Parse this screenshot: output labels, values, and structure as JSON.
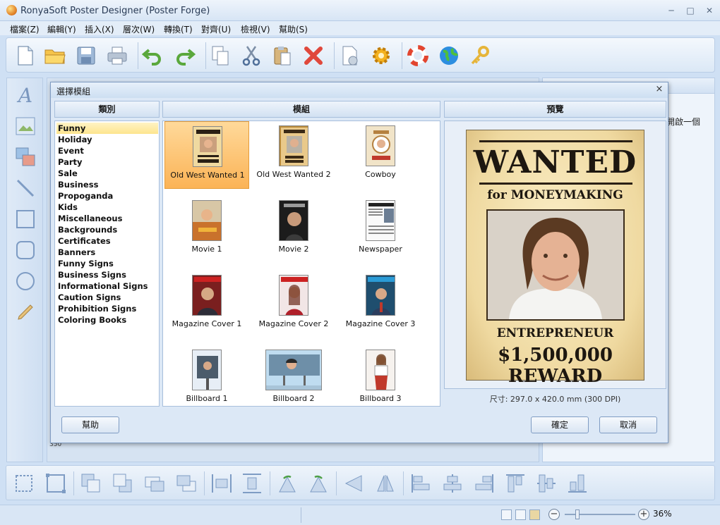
{
  "window": {
    "title": "RonyaSoft Poster Designer (Poster Forge)",
    "minimize_glyph": "─",
    "maximize_glyph": "□",
    "close_glyph": "✕"
  },
  "menu": [
    "檔案(Z)",
    "編輯(Y)",
    "插入(X)",
    "層次(W)",
    "轉換(T)",
    "對齊(U)",
    "檢視(V)",
    "幫助(S)"
  ],
  "toolbar_icons": [
    "new-icon",
    "open-folder-icon",
    "save-icon",
    "print-icon",
    "undo-icon",
    "redo-icon",
    "copy-icon",
    "cut-icon",
    "paste-icon",
    "delete-icon",
    "properties-icon",
    "settings-gear-icon",
    "help-lifebuoy-icon",
    "web-globe-icon",
    "register-key-icon"
  ],
  "left_tools": [
    "text-tool-icon",
    "image-tool-icon",
    "clipart-tool-icon",
    "line-tool-icon",
    "rectangle-tool-icon",
    "rounded-rectangle-tool-icon",
    "ellipse-tool-icon",
    "pencil-tool-icon"
  ],
  "side": {
    "right_panel_text": "開啟一個",
    "ruler_number": "350"
  },
  "dialog": {
    "title": "選擇模組",
    "close_glyph": "×",
    "headers": {
      "category": "類別",
      "templates": "模組",
      "preview": "預覽"
    },
    "categories": [
      "Funny",
      "Holiday",
      "Event",
      "Party",
      "Sale",
      "Business",
      "Propoganda",
      "Kids",
      "Miscellaneous",
      "Backgrounds",
      "Certificates",
      "Banners",
      "Funny Signs",
      "Business Signs",
      "Informational Signs",
      "Caution Signs",
      "Prohibition Signs",
      "Coloring Books"
    ],
    "selected_category": "Funny",
    "templates": [
      {
        "label": "Old West Wanted 1"
      },
      {
        "label": "Old West Wanted 2"
      },
      {
        "label": "Cowboy"
      },
      {
        "label": "Movie 1"
      },
      {
        "label": "Movie 2"
      },
      {
        "label": "Newspaper"
      },
      {
        "label": "Magazine Cover 1"
      },
      {
        "label": "Magazine Cover 2"
      },
      {
        "label": "Magazine Cover 3"
      },
      {
        "label": "Billboard 1"
      },
      {
        "label": "Billboard 2"
      },
      {
        "label": "Billboard 3"
      }
    ],
    "selected_template": "Old West Wanted 1",
    "preview": {
      "wanted": "WANTED",
      "subtitle": "for MONEYMAKING",
      "name": "ENTREPRENEUR",
      "reward": "$1,500,000 REWARD",
      "size_text": "尺寸: 297.0 x 420.0 mm (300 DPI)"
    },
    "buttons": {
      "help": "幫助",
      "ok": "確定",
      "cancel": "取消"
    }
  },
  "status": {
    "zoom": "36%"
  },
  "colors": {
    "selected_template": "#fbb356",
    "selected_category": "#fde58e",
    "frame": "#cfe0f4"
  }
}
